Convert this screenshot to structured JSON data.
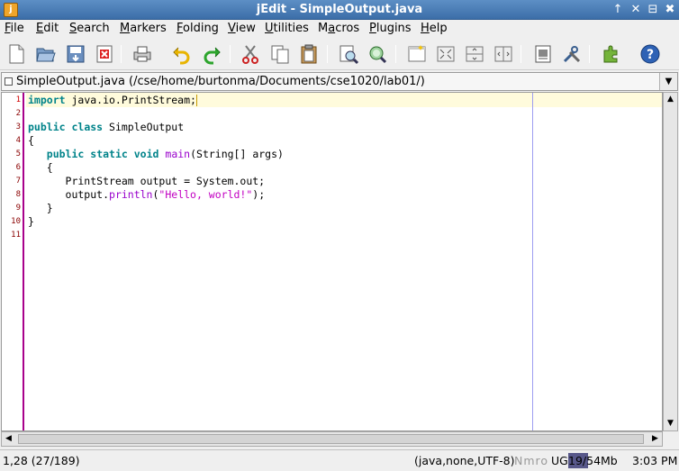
{
  "window": {
    "title": "jEdit - SimpleOutput.java",
    "controls": [
      "↑",
      "✕",
      "⊟",
      "✖"
    ]
  },
  "menubar": [
    {
      "label": "File",
      "mnemonic": "F",
      "rest": "ile"
    },
    {
      "label": "Edit",
      "mnemonic": "E",
      "rest": "dit"
    },
    {
      "label": "Search",
      "mnemonic": "S",
      "rest": "earch"
    },
    {
      "label": "Markers",
      "mnemonic": "M",
      "rest": "arkers"
    },
    {
      "label": "Folding",
      "mnemonic": "F",
      "rest": "olding"
    },
    {
      "label": "View",
      "mnemonic": "V",
      "rest": "iew"
    },
    {
      "label": "Utilities",
      "mnemonic": "U",
      "rest": "tilities"
    },
    {
      "label": "Macros",
      "mnemonic": "a",
      "rest_pre": "M",
      "rest": "cros"
    },
    {
      "label": "Plugins",
      "mnemonic": "P",
      "rest": "lugins"
    },
    {
      "label": "Help",
      "mnemonic": "H",
      "rest": "elp"
    }
  ],
  "toolbar": [
    "new-file-icon",
    "open-file-icon",
    "save-file-icon",
    "close-file-icon",
    "print-icon",
    "undo-icon",
    "redo-icon",
    "cut-icon",
    "copy-icon",
    "paste-icon",
    "find-icon",
    "find-in-files-icon",
    "new-view-icon",
    "unsplit-icon",
    "split-horizontal-icon",
    "split-vertical-icon",
    "buffer-options-icon",
    "global-options-icon",
    "plugin-manager-icon",
    "help-icon"
  ],
  "buffer": {
    "label": "SimpleOutput.java (/cse/home/burtonma/Documents/cse1020/lab01/)"
  },
  "editor": {
    "line_numbers": [
      "1",
      "2",
      "3",
      "4",
      "5",
      "6",
      "7",
      "8",
      "9",
      "10",
      "11"
    ],
    "lines": [
      {
        "tokens": [
          {
            "t": "import",
            "c": "kw"
          },
          {
            "t": " java.io.PrintStream;",
            "c": ""
          }
        ]
      },
      {
        "tokens": []
      },
      {
        "tokens": [
          {
            "t": "public",
            "c": "kw"
          },
          {
            "t": " ",
            "c": ""
          },
          {
            "t": "class",
            "c": "kw"
          },
          {
            "t": " SimpleOutput",
            "c": ""
          }
        ]
      },
      {
        "tokens": [
          {
            "t": "{",
            "c": ""
          }
        ]
      },
      {
        "tokens": [
          {
            "t": "   ",
            "c": ""
          },
          {
            "t": "public",
            "c": "kw"
          },
          {
            "t": " ",
            "c": ""
          },
          {
            "t": "static",
            "c": "kw"
          },
          {
            "t": " ",
            "c": ""
          },
          {
            "t": "void",
            "c": "kw"
          },
          {
            "t": " ",
            "c": ""
          },
          {
            "t": "main",
            "c": "fn"
          },
          {
            "t": "(String[] args)",
            "c": ""
          }
        ]
      },
      {
        "tokens": [
          {
            "t": "   {",
            "c": ""
          }
        ]
      },
      {
        "tokens": [
          {
            "t": "      PrintStream output = System.out;",
            "c": ""
          }
        ]
      },
      {
        "tokens": [
          {
            "t": "      output.",
            "c": ""
          },
          {
            "t": "println",
            "c": "fn"
          },
          {
            "t": "(",
            "c": ""
          },
          {
            "t": "\"Hello, world!\"",
            "c": "str"
          },
          {
            "t": ");",
            "c": ""
          }
        ]
      },
      {
        "tokens": [
          {
            "t": "   }",
            "c": ""
          }
        ]
      },
      {
        "tokens": [
          {
            "t": "}",
            "c": ""
          }
        ]
      },
      {
        "tokens": []
      }
    ]
  },
  "status": {
    "caret": "1,28 (27/189)",
    "mode": "(java,none,UTF-8)",
    "flags": "Nmro",
    "ug": "UG",
    "memory": "19/54Mb",
    "memory_used_fraction": 0.35,
    "time": "3:03 PM"
  },
  "colors": {
    "titlebar": "#4a7cb5",
    "gutter_border": "#a8018b",
    "keyword": "#00838a",
    "function": "#9900cc",
    "string": "#c200c2",
    "current_line": "#fffbdc",
    "wrap_guide": "#9c9cf0"
  }
}
